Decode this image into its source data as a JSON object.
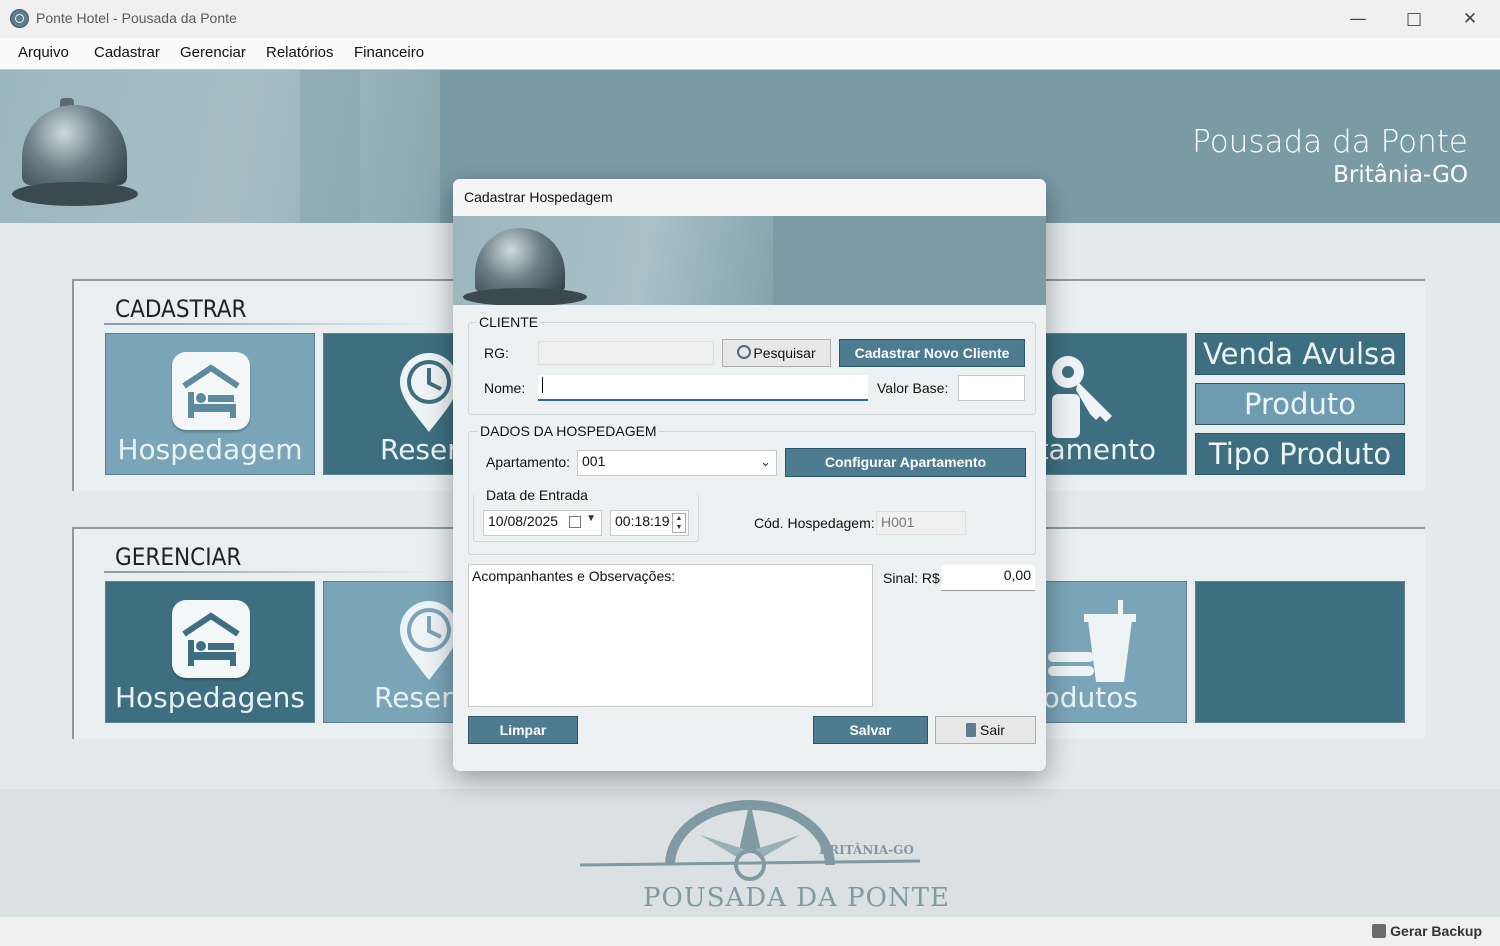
{
  "window": {
    "title": "Ponte Hotel - Pousada da Ponte"
  },
  "menu": [
    "Arquivo",
    "Cadastrar",
    "Gerenciar",
    "Relatórios",
    "Financeiro"
  ],
  "banner": {
    "title": "Pousada da Ponte",
    "subtitle": "Britânia-GO"
  },
  "cadastrar": {
    "title": "CADASTRAR",
    "tiles": [
      "Hospedagem",
      "Reservas",
      "Apartamento"
    ],
    "right_buttons": [
      "Venda Avulsa",
      "Produto",
      "Tipo Produto"
    ]
  },
  "gerenciar": {
    "title": "GERENCIAR",
    "tiles": [
      "Hospedagens",
      "Reservas",
      "Produtos"
    ]
  },
  "footer_logo": {
    "name": "POUSADA DA PONTE",
    "place": "BRITÂNIA-GO"
  },
  "statusbar": {
    "backup_label": "Gerar Backup"
  },
  "dialog": {
    "title": "Cadastrar Hospedagem",
    "cliente": {
      "caption": "CLIENTE",
      "rg_label": "RG:",
      "rg_value": "",
      "search_label": "Pesquisar",
      "new_client_label": "Cadastrar Novo Cliente",
      "nome_label": "Nome:",
      "nome_value": "",
      "valor_base_label": "Valor Base:",
      "valor_base_value": ""
    },
    "hospedagem": {
      "caption": "DADOS DA HOSPEDAGEM",
      "apartamento_label": "Apartamento:",
      "apartamento_value": "001",
      "config_label": "Configurar Apartamento",
      "data_entrada_caption": "Data de Entrada",
      "date_value": "10/08/2025",
      "time_value": "00:18:19",
      "cod_label": "Cód. Hospedagem:",
      "cod_value": "H001"
    },
    "observacoes_label": "Acompanhantes e Observações:",
    "sinal_label": "Sinal: R$",
    "sinal_value": "0,00",
    "limpar_label": "Limpar",
    "salvar_label": "Salvar",
    "sair_label": "Sair"
  }
}
